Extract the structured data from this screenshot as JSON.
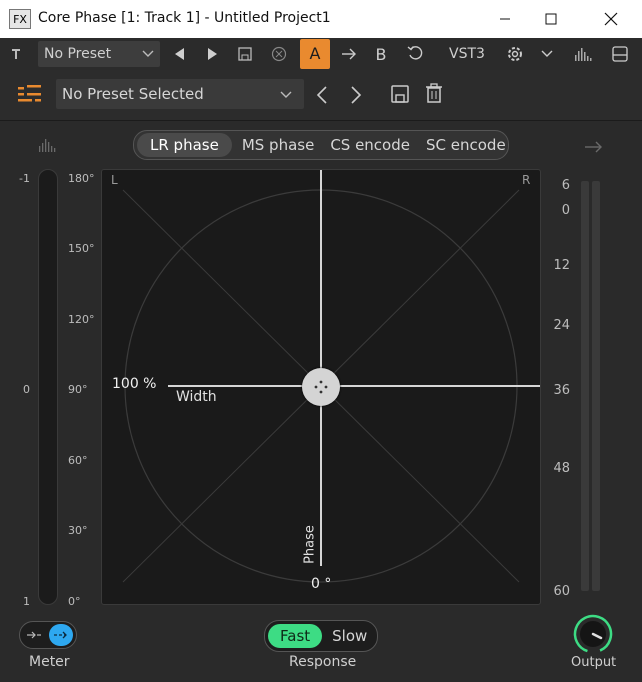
{
  "window": {
    "fx_badge": "FX",
    "title": "Core Phase [1: Track 1] - Untitled Project1"
  },
  "host_toolbar": {
    "preset": "No Preset",
    "ab_a": "A",
    "ab_b": "B",
    "format": "VST3"
  },
  "plugin_header": {
    "preset": "No Preset Selected"
  },
  "modes": [
    "LR phase",
    "MS phase",
    "CS encode",
    "SC encode"
  ],
  "active_mode": "LR phase",
  "left_meter": {
    "scale": [
      "-1",
      "0",
      "1"
    ]
  },
  "angle_scale": [
    "180°",
    "150°",
    "120°",
    "90°",
    "60°",
    "30°",
    "0°"
  ],
  "scope": {
    "corner_left": "L",
    "corner_right": "R",
    "width_value": "100 %",
    "width_label": "Width",
    "phase_label": "Phase",
    "phase_value": "0 °"
  },
  "output_meter": {
    "scale": [
      "6",
      "0",
      "12",
      "24",
      "36",
      "48",
      "60"
    ]
  },
  "meter_mode": {
    "label": "Meter"
  },
  "response": {
    "label": "Response",
    "options": [
      "Fast",
      "Slow"
    ],
    "selected": "Fast"
  },
  "output": {
    "label": "Output"
  },
  "colors": {
    "accent_green": "#3ddc84",
    "accent_blue": "#2ea8f0",
    "accent_orange": "#e98a2f",
    "ab_active_bg": "#e98a2f"
  }
}
